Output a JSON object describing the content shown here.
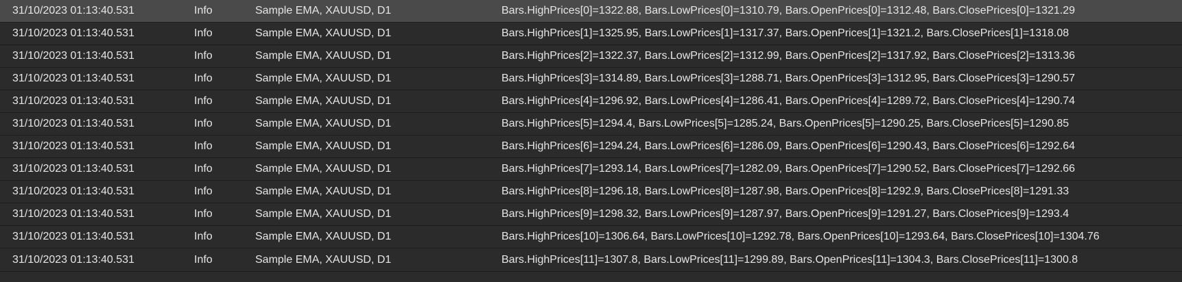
{
  "log": {
    "rows": [
      {
        "time": "31/10/2023 01:13:40.531",
        "level": "Info",
        "source": "Sample EMA, XAUUSD, D1",
        "message": "Bars.HighPrices[0]=1322.88, Bars.LowPrices[0]=1310.79, Bars.OpenPrices[0]=1312.48, Bars.ClosePrices[0]=1321.29"
      },
      {
        "time": "31/10/2023 01:13:40.531",
        "level": "Info",
        "source": "Sample EMA, XAUUSD, D1",
        "message": "Bars.HighPrices[1]=1325.95, Bars.LowPrices[1]=1317.37, Bars.OpenPrices[1]=1321.2, Bars.ClosePrices[1]=1318.08"
      },
      {
        "time": "31/10/2023 01:13:40.531",
        "level": "Info",
        "source": "Sample EMA, XAUUSD, D1",
        "message": "Bars.HighPrices[2]=1322.37, Bars.LowPrices[2]=1312.99, Bars.OpenPrices[2]=1317.92, Bars.ClosePrices[2]=1313.36"
      },
      {
        "time": "31/10/2023 01:13:40.531",
        "level": "Info",
        "source": "Sample EMA, XAUUSD, D1",
        "message": "Bars.HighPrices[3]=1314.89, Bars.LowPrices[3]=1288.71, Bars.OpenPrices[3]=1312.95, Bars.ClosePrices[3]=1290.57"
      },
      {
        "time": "31/10/2023 01:13:40.531",
        "level": "Info",
        "source": "Sample EMA, XAUUSD, D1",
        "message": "Bars.HighPrices[4]=1296.92, Bars.LowPrices[4]=1286.41, Bars.OpenPrices[4]=1289.72, Bars.ClosePrices[4]=1290.74"
      },
      {
        "time": "31/10/2023 01:13:40.531",
        "level": "Info",
        "source": "Sample EMA, XAUUSD, D1",
        "message": "Bars.HighPrices[5]=1294.4, Bars.LowPrices[5]=1285.24, Bars.OpenPrices[5]=1290.25, Bars.ClosePrices[5]=1290.85"
      },
      {
        "time": "31/10/2023 01:13:40.531",
        "level": "Info",
        "source": "Sample EMA, XAUUSD, D1",
        "message": "Bars.HighPrices[6]=1294.24, Bars.LowPrices[6]=1286.09, Bars.OpenPrices[6]=1290.43, Bars.ClosePrices[6]=1292.64"
      },
      {
        "time": "31/10/2023 01:13:40.531",
        "level": "Info",
        "source": "Sample EMA, XAUUSD, D1",
        "message": "Bars.HighPrices[7]=1293.14, Bars.LowPrices[7]=1282.09, Bars.OpenPrices[7]=1290.52, Bars.ClosePrices[7]=1292.66"
      },
      {
        "time": "31/10/2023 01:13:40.531",
        "level": "Info",
        "source": "Sample EMA, XAUUSD, D1",
        "message": "Bars.HighPrices[8]=1296.18, Bars.LowPrices[8]=1287.98, Bars.OpenPrices[8]=1292.9, Bars.ClosePrices[8]=1291.33"
      },
      {
        "time": "31/10/2023 01:13:40.531",
        "level": "Info",
        "source": "Sample EMA, XAUUSD, D1",
        "message": "Bars.HighPrices[9]=1298.32, Bars.LowPrices[9]=1287.97, Bars.OpenPrices[9]=1291.27, Bars.ClosePrices[9]=1293.4"
      },
      {
        "time": "31/10/2023 01:13:40.531",
        "level": "Info",
        "source": "Sample EMA, XAUUSD, D1",
        "message": "Bars.HighPrices[10]=1306.64, Bars.LowPrices[10]=1292.78, Bars.OpenPrices[10]=1293.64, Bars.ClosePrices[10]=1304.76"
      },
      {
        "time": "31/10/2023 01:13:40.531",
        "level": "Info",
        "source": "Sample EMA, XAUUSD, D1",
        "message": "Bars.HighPrices[11]=1307.8, Bars.LowPrices[11]=1299.89, Bars.OpenPrices[11]=1304.3, Bars.ClosePrices[11]=1300.8"
      }
    ],
    "selected_row": 0
  },
  "colors": {
    "background": "#2b2b2b",
    "selected_background": "#4a4a4a",
    "text": "#e6e6e6",
    "separator": "#1c1c1c"
  }
}
